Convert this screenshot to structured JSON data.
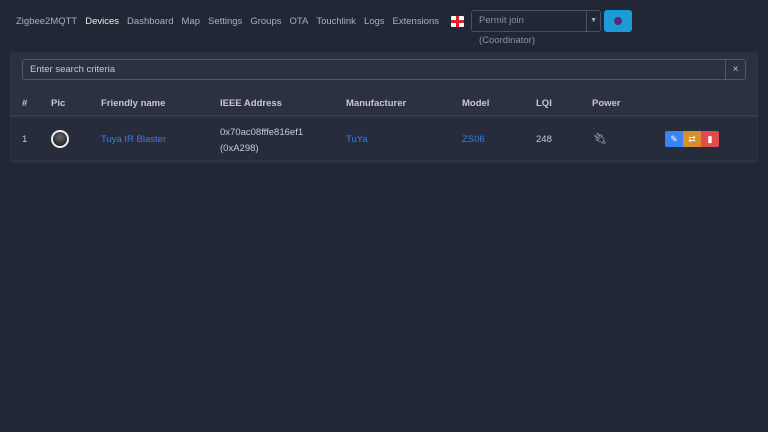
{
  "nav": {
    "brand": "Zigbee2MQTT",
    "items": [
      "Devices",
      "Dashboard",
      "Map",
      "Settings",
      "Groups",
      "OTA",
      "Touchlink",
      "Logs",
      "Extensions"
    ],
    "permit_join": "Permit join (Coordinator)"
  },
  "search": {
    "placeholder": "Enter search criteria",
    "clear": "×"
  },
  "table": {
    "headers": [
      "#",
      "Pic",
      "Friendly name",
      "IEEE Address",
      "Manufacturer",
      "Model",
      "LQI",
      "Power"
    ],
    "rows": [
      {
        "index": "1",
        "friendly_name": "Tuya IR Blaster",
        "ieee": "0x70ac08fffe816ef1",
        "nwk": "(0xA298)",
        "manufacturer": "TuYa",
        "model": "ZS06",
        "lqi": "248",
        "power_icon": "plug-icon"
      }
    ]
  },
  "colors": {
    "accent": "#3b7ddd",
    "edit": "#3b82f6",
    "rename": "#d68f2c",
    "delete": "#e04b4b"
  }
}
